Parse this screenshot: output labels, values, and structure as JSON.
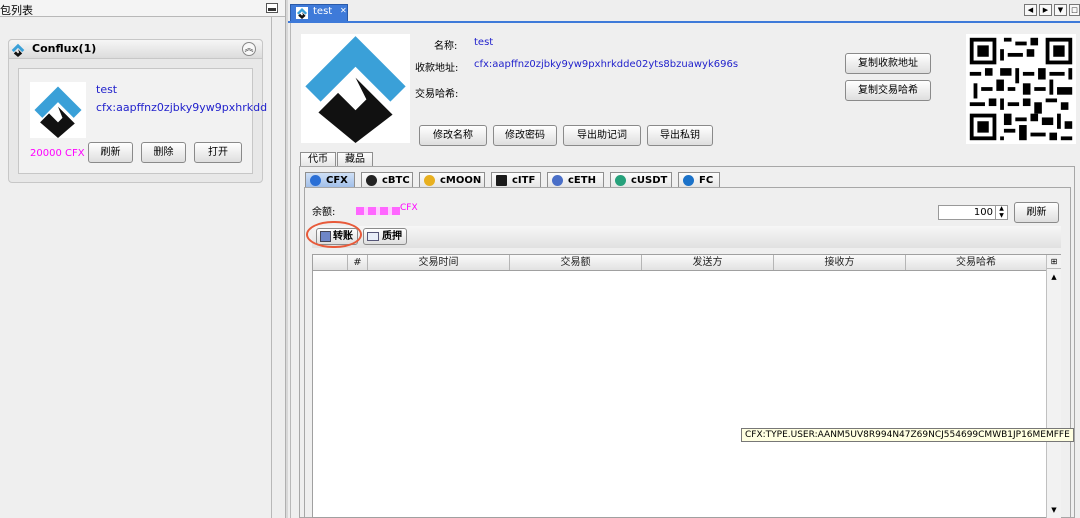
{
  "left": {
    "panel_title": "包列表",
    "group_title": "Conflux(1)",
    "wallet": {
      "name": "test",
      "address": "cfx:aapffnz0zjbky9yw9pxhrkdd",
      "balance": "20000 CFX"
    },
    "buttons": {
      "refresh": "刷新",
      "delete": "删除",
      "open": "打开"
    }
  },
  "doc_tab": {
    "label": "test"
  },
  "detail": {
    "name_label": "名称:",
    "name_value": "test",
    "address_label": "收款地址:",
    "address_value": "cfx:aapffnz0zjbky9yw9pxhrkdde02yts8bzuawyk696s",
    "txhash_label": "交易哈希:",
    "buttons": {
      "rename": "修改名称",
      "change_password": "修改密码",
      "export_mnemonic": "导出助记词",
      "export_private_key": "导出私钥",
      "copy_address": "复制收款地址",
      "copy_txhash": "复制交易哈希"
    }
  },
  "asset_tabs": [
    "代币",
    "藏品"
  ],
  "coin_tabs": [
    {
      "label": "CFX",
      "color": "#2a6fd6",
      "selected": true
    },
    {
      "label": "cBTC",
      "color": "#222222"
    },
    {
      "label": "cMOON",
      "color": "#e8b020"
    },
    {
      "label": "cITF",
      "color": "#1a1a1a"
    },
    {
      "label": "cETH",
      "color": "#4a6fc8"
    },
    {
      "label": "cUSDT",
      "color": "#26a17b"
    },
    {
      "label": "FC",
      "color": "#1b72c9"
    }
  ],
  "balance": {
    "label": "余额:",
    "unit": "CFX",
    "page_size": "100",
    "refresh": "刷新"
  },
  "actions": {
    "transfer": "转账",
    "stake": "质押"
  },
  "table": {
    "columns": [
      "#",
      "交易时间",
      "交易额",
      "发送方",
      "接收方",
      "交易哈希"
    ]
  },
  "tooltip": "CFX:TYPE.USER:AANM5UV8R994N47Z69NCJ554699CMWB1JP16MEMFFE",
  "colors": {
    "accent": "#3e7ad9",
    "link": "#2222cc",
    "balance": "#ff00ff",
    "highlight": "#e85a3a"
  }
}
